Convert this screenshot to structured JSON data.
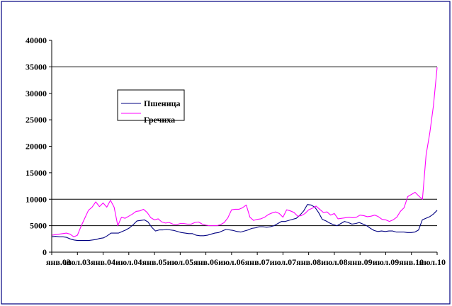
{
  "chart_data": {
    "type": "line",
    "title": "",
    "xlabel": "",
    "ylabel": "",
    "ylim": [
      0,
      40000
    ],
    "yticks": [
      0,
      5000,
      10000,
      15000,
      20000,
      25000,
      30000,
      35000,
      40000
    ],
    "x_tick_labels": [
      "янв.03",
      "июл.03",
      "янв.04",
      "июл.04",
      "янв.05",
      "июл.05",
      "янв.06",
      "июл.06",
      "янв.07",
      "июл.07",
      "янв.08",
      "июл.08",
      "янв.09",
      "июл.09",
      "янв.10",
      "июл.10"
    ],
    "grid": {
      "horizontal_at": [
        5000,
        10000,
        35000
      ],
      "vertical": false
    },
    "legend": {
      "placement": "upper-middle-left"
    },
    "colors": {
      "plot_background": "#ffffff",
      "outer_frame": "#000080"
    },
    "series": [
      {
        "name": "Пшеница",
        "color": "#000080",
        "values": [
          2900,
          3000,
          2900,
          2900,
          2800,
          2500,
          2300,
          2200,
          2200,
          2200,
          2200,
          2300,
          2400,
          2600,
          2700,
          3100,
          3600,
          3600,
          3600,
          3900,
          4200,
          4600,
          5200,
          5900,
          6000,
          6100,
          5700,
          4700,
          4000,
          4200,
          4200,
          4300,
          4200,
          4100,
          3900,
          3700,
          3600,
          3500,
          3500,
          3200,
          3100,
          3100,
          3200,
          3400,
          3600,
          3700,
          4000,
          4300,
          4200,
          4100,
          3900,
          3800,
          4000,
          4200,
          4500,
          4600,
          4800,
          4800,
          4700,
          4800,
          5000,
          5400,
          5800,
          5800,
          6000,
          6200,
          6400,
          7000,
          7800,
          9000,
          8900,
          8500,
          7500,
          6200,
          5900,
          5500,
          5200,
          5000,
          5400,
          5800,
          5600,
          5300,
          5400,
          5600,
          5300,
          5000,
          4500,
          4100,
          3900,
          4000,
          3900,
          4000,
          4000,
          3800,
          3800,
          3800,
          3700,
          3700,
          3800,
          4200,
          6100,
          6400,
          6700,
          7200,
          7900
        ]
      },
      {
        "name": "Гречиха",
        "color": "#ff00ff",
        "values": [
          3200,
          3300,
          3400,
          3500,
          3600,
          3400,
          2900,
          3200,
          4900,
          6400,
          7900,
          8500,
          9500,
          8600,
          9300,
          8500,
          9800,
          8500,
          5000,
          6600,
          6400,
          6800,
          7200,
          7700,
          7800,
          8100,
          7500,
          6500,
          6100,
          6300,
          5700,
          5500,
          5600,
          5300,
          5200,
          5400,
          5400,
          5300,
          5300,
          5600,
          5700,
          5300,
          5100,
          5000,
          5000,
          5000,
          5200,
          5600,
          6500,
          8000,
          8100,
          8100,
          8400,
          8900,
          6600,
          6000,
          6200,
          6300,
          6600,
          7100,
          7400,
          7600,
          7300,
          6600,
          8000,
          7800,
          7500,
          6800,
          6900,
          7300,
          8000,
          8300,
          8700,
          8100,
          7500,
          7600,
          7000,
          7300,
          6300,
          6400,
          6500,
          6600,
          6500,
          6600,
          7000,
          6900,
          6700,
          6800,
          7000,
          6700,
          6200,
          6100,
          5800,
          6100,
          6600,
          7700,
          8400,
          10500,
          10900,
          11300,
          10600,
          10000,
          18400,
          22500,
          27700,
          34900
        ]
      }
    ]
  }
}
